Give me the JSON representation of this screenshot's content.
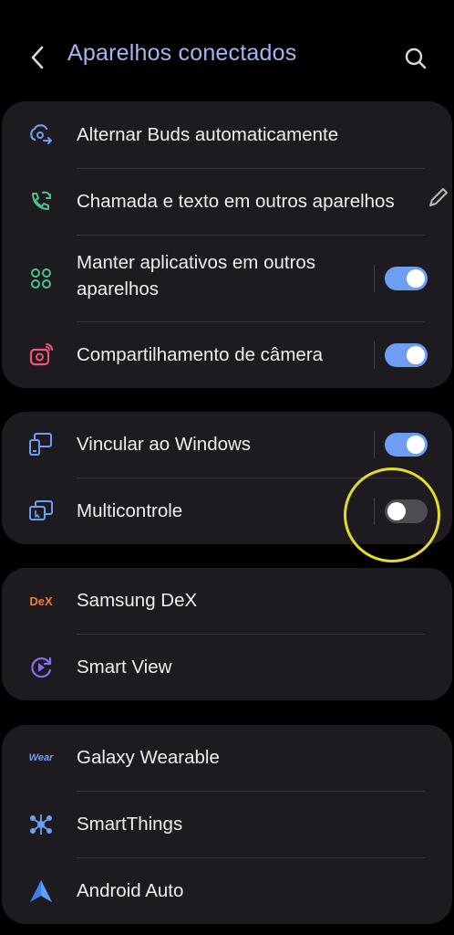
{
  "header": {
    "title": "Aparelhos conectados"
  },
  "group1": {
    "items": [
      {
        "label": "Alternar Buds automaticamente"
      },
      {
        "label": "Chamada e texto em outros aparelhos"
      },
      {
        "label_line1": "Manter aplicativos em outros",
        "label_line2": "aparelhos",
        "toggle": "on"
      },
      {
        "label": "Compartilhamento de câmera",
        "toggle": "on"
      }
    ]
  },
  "group2": {
    "items": [
      {
        "label": "Vincular ao Windows",
        "toggle": "on"
      },
      {
        "label": "Multicontrole",
        "toggle": "off"
      }
    ]
  },
  "group3": {
    "items": [
      {
        "label": "Samsung DeX",
        "icon_text": "DeX"
      },
      {
        "label": "Smart View"
      }
    ]
  },
  "group4": {
    "items": [
      {
        "label": "Galaxy Wearable",
        "icon_text": "Wear"
      },
      {
        "label": "SmartThings"
      },
      {
        "label": "Android Auto"
      }
    ]
  },
  "colors": {
    "background": "#000000",
    "card": "#1d1b20",
    "title": "#9fb6f2",
    "toggle_on": "#6e9ef3",
    "toggle_off": "#4f4d54",
    "highlight": "#e5dc2a"
  }
}
